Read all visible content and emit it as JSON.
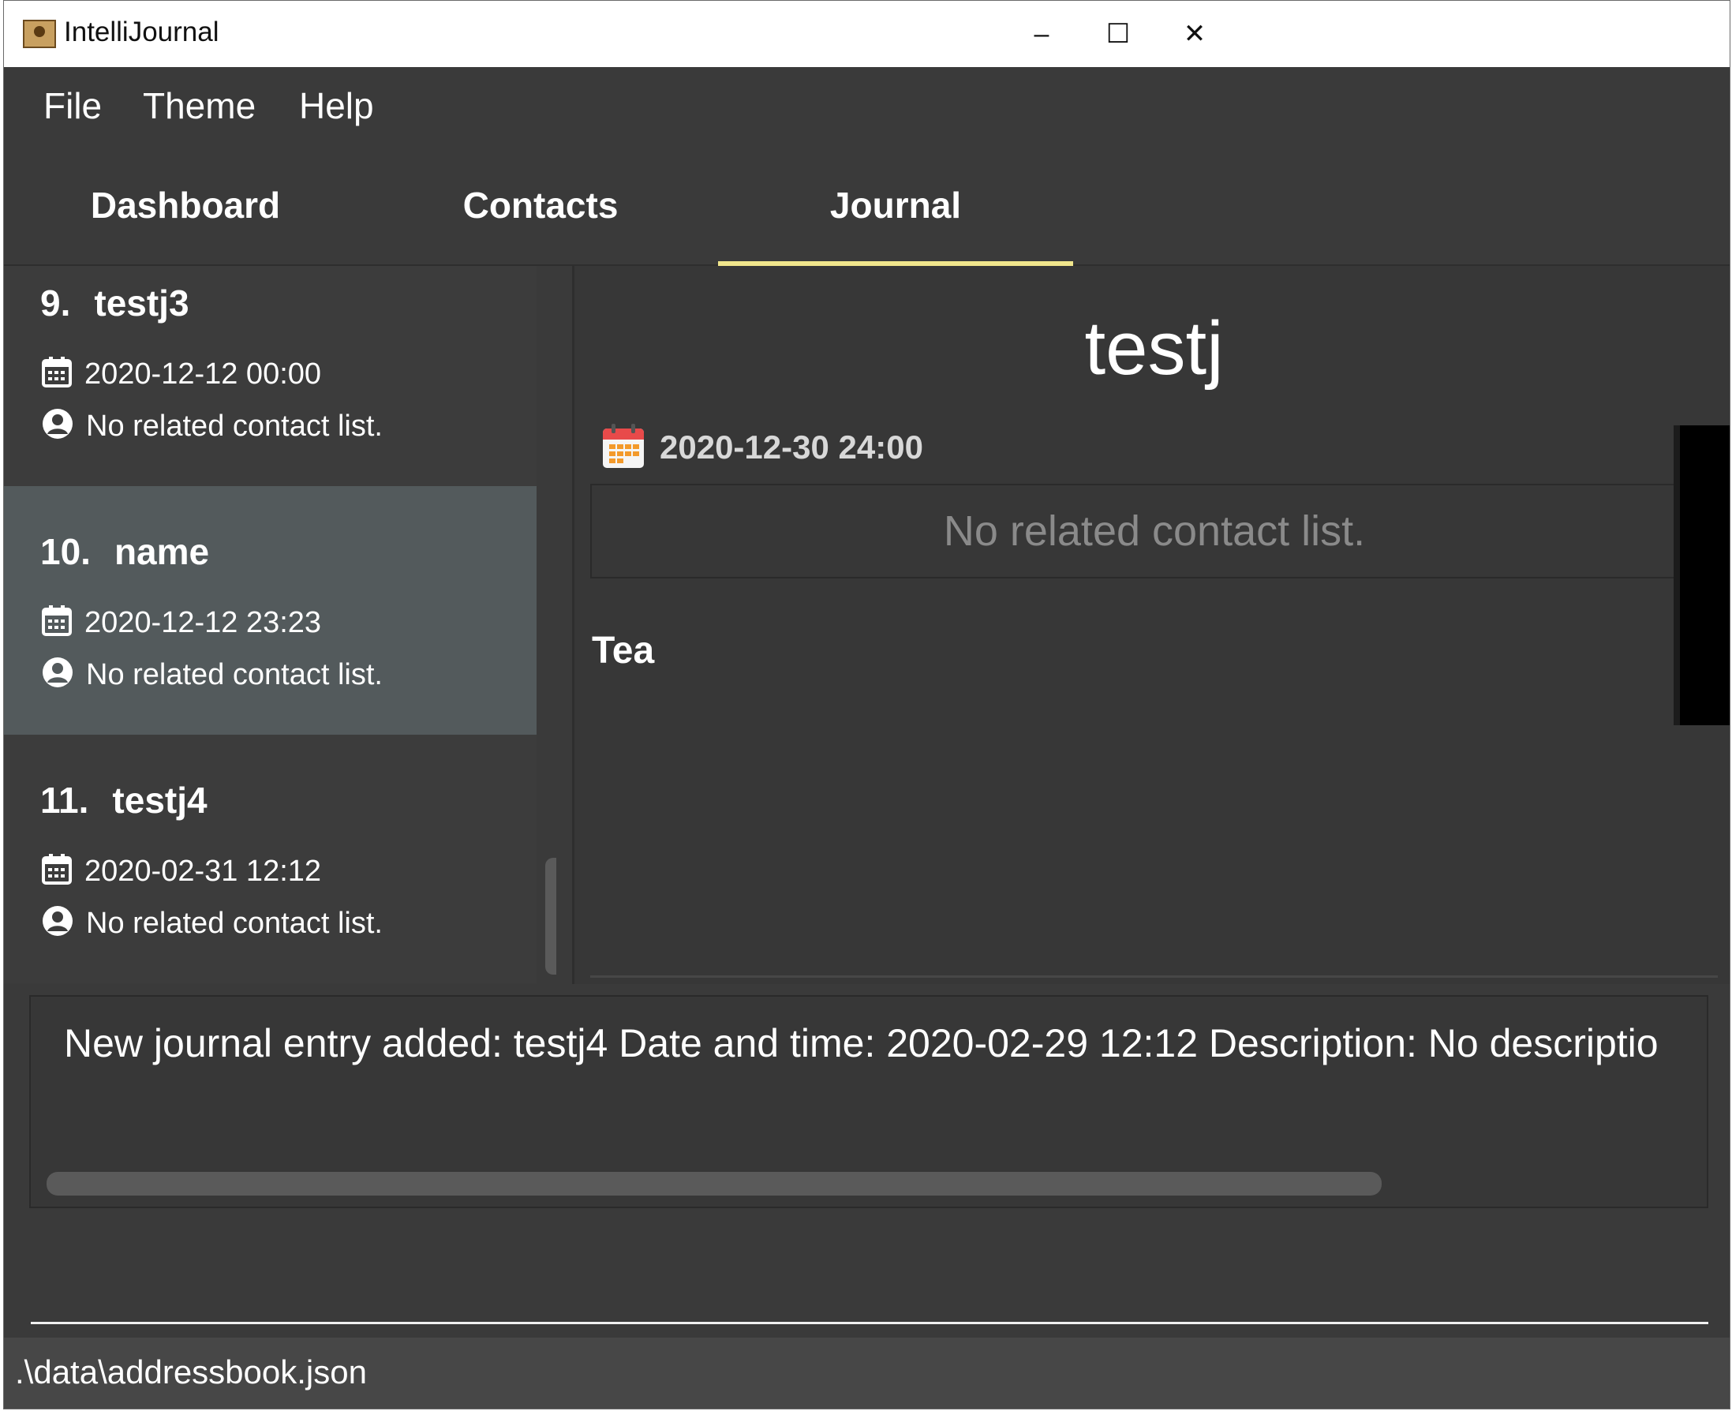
{
  "window": {
    "title": "IntelliJournal",
    "controls": [
      "–",
      "☐",
      "✕"
    ]
  },
  "menu": [
    "File",
    "Theme",
    "Help"
  ],
  "tabs": [
    {
      "label": "Dashboard",
      "active": false
    },
    {
      "label": "Contacts",
      "active": false
    },
    {
      "label": "Journal",
      "active": true
    }
  ],
  "entries": [
    {
      "index": "9.",
      "name": "testj3",
      "date": "2020-12-12 00:00",
      "contacts": "No related contact list.",
      "selected": false
    },
    {
      "index": "10.",
      "name": "name",
      "date": "2020-12-12 23:23",
      "contacts": "No related contact list.",
      "selected": true
    },
    {
      "index": "11.",
      "name": "testj4",
      "date": "2020-02-31 12:12",
      "contacts": "No related contact list.",
      "selected": false
    }
  ],
  "detail": {
    "title": "testj",
    "date": "2020-12-30 24:00",
    "contacts": "No related contact list.",
    "description": "Tea"
  },
  "result": {
    "text": "New journal entry added: testj4 Date and time: 2020-02-29 12:12 Description: No descriptio"
  },
  "status": {
    "path": ".\\data\\addressbook.json"
  },
  "colors": {
    "background": "#3a3a3a",
    "selected_card": "#535a5c",
    "tab_underline": "#f0e68c"
  }
}
